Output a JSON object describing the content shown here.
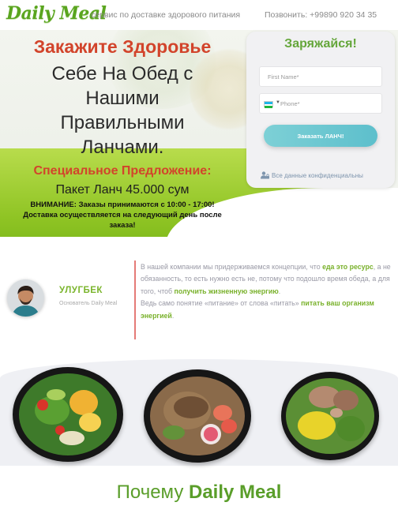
{
  "header": {
    "logo": "Daily Meal",
    "tagline": "сервис по доставке здорового питания",
    "phone": "Позвонить: +99890 920 34 35"
  },
  "hero": {
    "title": "Закажите Здоровье",
    "subtitle_lines": [
      "Себе На Обед с",
      "Нашими",
      "Правильными",
      "Ланчами."
    ],
    "offer_title": "Специальное Предложение:",
    "offer_price": "Пакет Ланч 45.000 сум",
    "notice_lines": [
      "ВНИМАНИЕ: Заказы принимаются с 10:00 - 17:00!",
      "Доставка осуществляется на следующий день после",
      "заказа!"
    ]
  },
  "form": {
    "title": "Заряжайся!",
    "first_name_placeholder": "First Name*",
    "phone_placeholder": "Phone*",
    "submit_label": "Заказать ЛАНЧ!",
    "privacy_text": "Все данные конфиденциальны"
  },
  "about": {
    "author_name": "УЛУГБЕК",
    "author_role": "Основатель Daily Meal",
    "paragraph1": {
      "t1": "В нашей компании мы придерживаемся концепции, что ",
      "b1": "еда это ресурс",
      "t2": ", а не обязанность, то есть нужно есть не, потому что подошло время обеда, а для того, чтоб ",
      "b2": "получить жизненную энергию",
      "t3": "."
    },
    "paragraph2": {
      "t1": "Ведь само понятие «питание» от слова «питать» ",
      "b1": "питать ваш организм энергией",
      "t2": "."
    }
  },
  "why": {
    "prefix": "Почему ",
    "brand": "Daily Meal"
  },
  "colors": {
    "brand_green": "#64a63a",
    "accent_red": "#d2442b",
    "button_teal": "#6ac7d1",
    "divider": "#e57b77"
  },
  "icons": [
    "user-lock-icon",
    "uzbekistan-flag-icon",
    "caret-down-icon"
  ]
}
